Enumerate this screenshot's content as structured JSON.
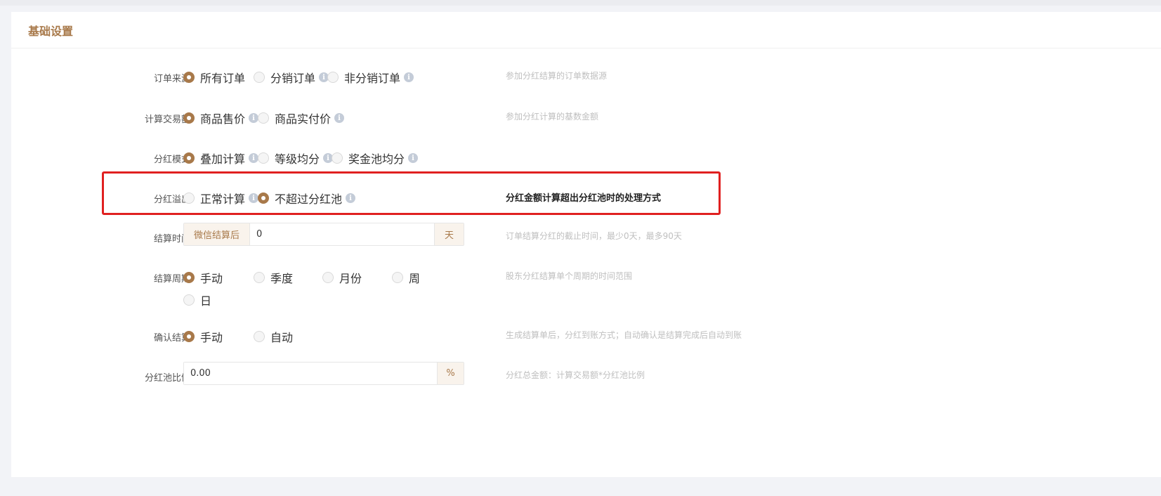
{
  "section": {
    "title": "基础设置"
  },
  "order_source": {
    "label": "订单来源",
    "options": [
      {
        "label": "所有订单",
        "checked": true,
        "info": false
      },
      {
        "label": "分销订单",
        "checked": false,
        "info": true
      },
      {
        "label": "非分销订单",
        "checked": false,
        "info": true
      }
    ],
    "hint": "参加分红结算的订单数据源"
  },
  "trade_amount": {
    "label": "计算交易额",
    "options": [
      {
        "label": "商品售价",
        "checked": true,
        "info": true
      },
      {
        "label": "商品实付价",
        "checked": false,
        "info": true
      }
    ],
    "hint": "参加分红计算的基数金额"
  },
  "dividend_mode": {
    "label": "分红模式",
    "options": [
      {
        "label": "叠加计算",
        "checked": true,
        "info": true
      },
      {
        "label": "等级均分",
        "checked": false,
        "info": true
      },
      {
        "label": "奖金池均分",
        "checked": false,
        "info": true
      }
    ]
  },
  "dividend_overflow": {
    "label": "分红溢出",
    "options": [
      {
        "label": "正常计算",
        "checked": false,
        "info": true
      },
      {
        "label": "不超过分红池",
        "checked": true,
        "info": true
      }
    ],
    "hint": "分红金额计算超出分红池时的处理方式"
  },
  "settle_time": {
    "label": "结算时间",
    "prefix": "微信结算后",
    "value": "0",
    "suffix": "天",
    "hint": "订单结算分红的截止时间，最少0天，最多90天"
  },
  "settle_cycle": {
    "label": "结算周期",
    "options": [
      {
        "label": "手动",
        "checked": true
      },
      {
        "label": "季度",
        "checked": false
      },
      {
        "label": "月份",
        "checked": false
      },
      {
        "label": "周",
        "checked": false
      },
      {
        "label": "日",
        "checked": false
      }
    ],
    "hint": "股东分红结算单个周期的时间范围"
  },
  "confirm_settle": {
    "label": "确认结算",
    "options": [
      {
        "label": "手动",
        "checked": true
      },
      {
        "label": "自动",
        "checked": false
      }
    ],
    "hint": "生成结算单后，分红到账方式；自动确认是结算完成后自动到账"
  },
  "pool_ratio": {
    "label": "分红池比例",
    "value": "0.00",
    "suffix": "%",
    "hint": "分红总金额：计算交易额*分红池比例"
  },
  "icons": {
    "info": "info-icon"
  },
  "colors": {
    "accent": "#a8794a",
    "highlight": "#e02020",
    "hint": "#bfbfbf"
  }
}
